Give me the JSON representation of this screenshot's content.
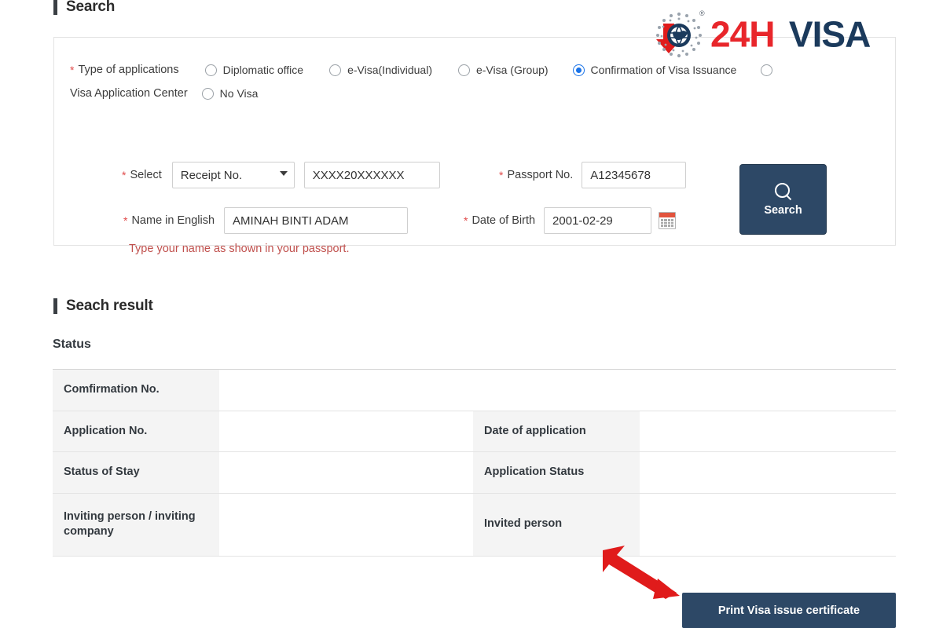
{
  "search_section": {
    "heading": "Search",
    "type_label": "Type of applications",
    "radios": [
      {
        "label": "Diplomatic office",
        "checked": false
      },
      {
        "label": "e-Visa(Individual)",
        "checked": false
      },
      {
        "label": "e-Visa (Group)",
        "checked": false
      },
      {
        "label": "Confirmation of Visa Issuance",
        "checked": true
      },
      {
        "label": "",
        "checked": false
      },
      {
        "label": "No Visa",
        "checked": false
      }
    ],
    "wrapped_label": "Visa Application Center",
    "select_label": "Select",
    "select_value": "Receipt No.",
    "select_options": [
      "Receipt No."
    ],
    "receipt_value": "XXXX20XXXXXX",
    "passport_label": "Passport No.",
    "passport_value": "A12345678",
    "name_label": "Name in English",
    "name_value": "AMINAH BINTI ADAM",
    "dob_label": "Date of Birth",
    "dob_value": "2001-02-29",
    "hint": "Type your name as shown in your passport.",
    "search_button": "Search"
  },
  "result_section": {
    "heading": "Seach result",
    "status_label": "Status",
    "rows": [
      {
        "label1": "Comfirmation No.",
        "value1": "",
        "label2": null,
        "value2": null
      },
      {
        "label1": "Application No.",
        "value1": "",
        "label2": "Date of application",
        "value2": ""
      },
      {
        "label1": "Status of Stay",
        "value1": "",
        "label2": "Application Status",
        "value2": ""
      },
      {
        "label1": "Inviting person / inviting company",
        "value1": "",
        "label2": "Invited person",
        "value2": ""
      }
    ],
    "print_button": "Print Visa issue certificate"
  },
  "logo": {
    "text_red": "24H",
    "text_navy": "VISA",
    "registered_mark": "®"
  },
  "colors": {
    "brand_red": "#E8262B",
    "brand_navy": "#1B3A5C",
    "button_navy": "#2D4866",
    "radio_blue": "#1A73E8",
    "hint_red": "#C0504D",
    "arrow_red": "#E01B1B"
  }
}
